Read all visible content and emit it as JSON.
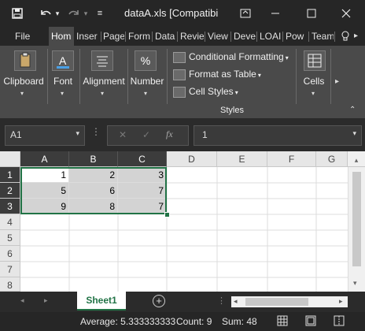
{
  "title_bar": {
    "title": "dataA.xls  [Compatibil...",
    "undo_menu": "▾",
    "qat_more": "≡"
  },
  "ribbon_tabs": [
    "File",
    "Hom",
    "Inser",
    "Page",
    "Form",
    "Data",
    "Revie",
    "View",
    "Deve",
    "LOAI",
    "Pow",
    "Team"
  ],
  "ribbon": {
    "clipboard": "Clipboard",
    "font": "Font",
    "alignment": "Alignment",
    "number": "Number",
    "conditional_formatting": "Conditional Formatting",
    "format_as_table": "Format as Table",
    "cell_styles": "Cell Styles",
    "styles_group": "Styles",
    "cells": "Cells",
    "percent_glyph": "%"
  },
  "formula_bar": {
    "name_box": "A1",
    "fx": "fx",
    "value": "1"
  },
  "columns": [
    "A",
    "B",
    "C",
    "D",
    "E",
    "F",
    "G"
  ],
  "rows": [
    "1",
    "2",
    "3",
    "4",
    "5",
    "6",
    "7",
    "8"
  ],
  "cells": [
    [
      "1",
      "2",
      "3"
    ],
    [
      "5",
      "6",
      "7"
    ],
    [
      "9",
      "8",
      "7"
    ]
  ],
  "sheet_tab": "Sheet1",
  "status_bar": {
    "average": "Average: 5.333333333",
    "count": "Count: 9",
    "sum": "Sum: 48"
  },
  "colors": {
    "selection_border": "#217346",
    "sheet_tab_text": "#217346",
    "ribbon_bg": "#4a4a4a"
  }
}
